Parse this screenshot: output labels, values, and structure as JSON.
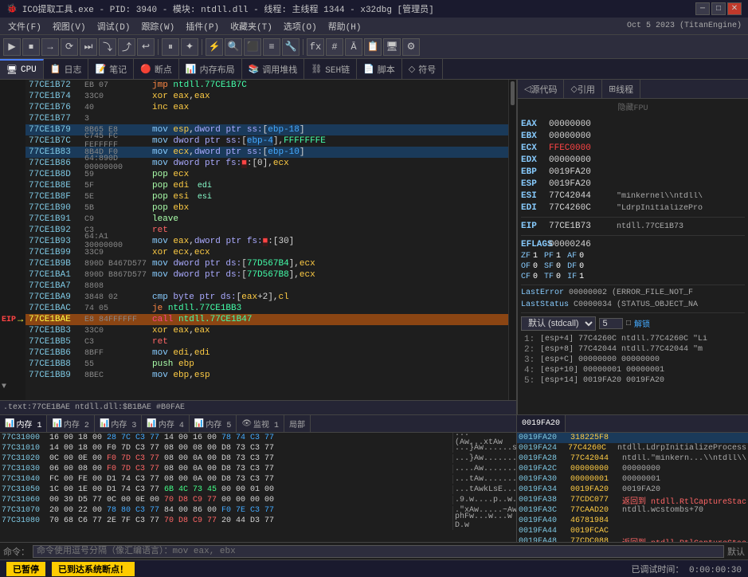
{
  "titlebar": {
    "title": "ICO提取工具.exe - PID: 3940 - 模块: ntdll.dll - 线程: 主线程 1344 - x32dbg [管理员]",
    "icon": "🐞",
    "controls": [
      "─",
      "□",
      "✕"
    ]
  },
  "menubar": {
    "items": [
      "文件(F)",
      "视图(V)",
      "调试(D)",
      "跟踪(W)",
      "插件(P)",
      "收藏夹(T)",
      "选项(O)",
      "帮助(H)"
    ],
    "date": "Oct 5 2023 (TitanEngine)"
  },
  "tabs": {
    "main": [
      {
        "label": "CPU",
        "icon": "🖥",
        "active": true
      },
      {
        "label": "日志",
        "icon": "📋",
        "active": false
      },
      {
        "label": "笔记",
        "icon": "📝",
        "active": false
      },
      {
        "label": "断点",
        "icon": "🔴",
        "active": false
      },
      {
        "label": "内存布局",
        "icon": "📊",
        "active": false
      },
      {
        "label": "调用堆栈",
        "icon": "📚",
        "active": false
      },
      {
        "label": "SEH链",
        "icon": "⛓",
        "active": false
      },
      {
        "label": "脚本",
        "icon": "📄",
        "active": false
      },
      {
        "label": "符号",
        "icon": "◇",
        "active": false
      }
    ],
    "right": [
      {
        "label": "源代码",
        "icon": "◁",
        "active": false
      },
      {
        "label": "引用",
        "icon": "◇",
        "active": false
      },
      {
        "label": "线程",
        "icon": "⊞",
        "active": false
      }
    ]
  },
  "disasm": {
    "eip_label": "EIP",
    "rows": [
      {
        "addr": "77CE1B72",
        "bytes": "EB 07",
        "mnem": "jmp ntdll.77CE1B7C",
        "type": "jmp",
        "eip": false,
        "selected": false,
        "highlighted": false
      },
      {
        "addr": "77CE1B74",
        "bytes": "33C0",
        "mnem": "xor eax,eax",
        "type": "xor",
        "eip": false,
        "selected": false,
        "highlighted": false
      },
      {
        "addr": "77CE1B76",
        "bytes": "40",
        "mnem": "inc eax",
        "type": "inc",
        "eip": false,
        "selected": false,
        "highlighted": false
      },
      {
        "addr": "77CE1B77",
        "bytes": "3",
        "mnem": "",
        "type": "",
        "eip": false,
        "selected": false,
        "highlighted": false
      },
      {
        "addr": "77CE1B79",
        "bytes": "8B65 E8",
        "mnem": "mov esp,dword ptr ss:[ebp-18]",
        "type": "mov",
        "eip": false,
        "selected": false,
        "highlighted": true
      },
      {
        "addr": "77CE1B7C",
        "bytes": "C745 FC FEFFFFF",
        "mnem": "mov dword ptr ss:[ebp-4],FFFFFFFE",
        "type": "mov",
        "eip": false,
        "selected": false,
        "highlighted": false
      },
      {
        "addr": "77CE1B83",
        "bytes": "8B4D F0",
        "mnem": "mov ecx,dword ptr ss:[ebp-10]",
        "type": "mov",
        "eip": false,
        "selected": false,
        "highlighted": true
      },
      {
        "addr": "77CE1B86",
        "bytes": "64:890D 00000000",
        "mnem": "mov dword ptr fs:■:[0],ecx",
        "type": "mov",
        "eip": false,
        "selected": false,
        "highlighted": false
      },
      {
        "addr": "77CE1B8D",
        "bytes": "59",
        "mnem": "pop ecx",
        "type": "pop",
        "eip": false,
        "selected": false,
        "highlighted": false
      },
      {
        "addr": "77CE1B8E",
        "bytes": "5F",
        "mnem": "pop edi",
        "type": "pop",
        "eip": false,
        "selected": false,
        "highlighted": false,
        "comment": "edi"
      },
      {
        "addr": "77CE1B8F",
        "bytes": "5E",
        "mnem": "pop esi",
        "type": "pop",
        "eip": false,
        "selected": false,
        "highlighted": false,
        "comment": "esi"
      },
      {
        "addr": "77CE1B90",
        "bytes": "5B",
        "mnem": "pop ebx",
        "type": "pop",
        "eip": false,
        "selected": false,
        "highlighted": false
      },
      {
        "addr": "77CE1B91",
        "bytes": "C9",
        "mnem": "leave",
        "type": "leave",
        "eip": false,
        "selected": false,
        "highlighted": false
      },
      {
        "addr": "77CE1B92",
        "bytes": "C3",
        "mnem": "ret",
        "type": "ret",
        "eip": false,
        "selected": false,
        "highlighted": false
      },
      {
        "addr": "77CE1B93",
        "bytes": "64:A1 30000000",
        "mnem": "mov eax,dword ptr fs:■:[30]",
        "type": "mov",
        "eip": false,
        "selected": false,
        "highlighted": false
      },
      {
        "addr": "77CE1B99",
        "bytes": "33C9",
        "mnem": "xor ecx,ecx",
        "type": "xor",
        "eip": false,
        "selected": false,
        "highlighted": false
      },
      {
        "addr": "77CE1B9B",
        "bytes": "890D B467D577",
        "mnem": "mov dword ptr ds:[77D567B4],ecx",
        "type": "mov",
        "eip": false,
        "selected": false,
        "highlighted": false
      },
      {
        "addr": "77CE1BA1",
        "bytes": "890D B867D577",
        "mnem": "mov dword ptr ds:[77D567B8],ecx",
        "type": "mov",
        "eip": false,
        "selected": false,
        "highlighted": false
      },
      {
        "addr": "77CE1BA7",
        "bytes": "8808",
        "mnem": "",
        "type": "",
        "eip": false,
        "selected": false,
        "highlighted": false
      },
      {
        "addr": "77CE1BA9",
        "bytes": "3848 02",
        "mnem": "cmp byte ptr ds:[eax+2],cl",
        "type": "cmp",
        "eip": false,
        "selected": false,
        "highlighted": false
      },
      {
        "addr": "77CE1BAC",
        "bytes": "74 05",
        "mnem": "je ntdll.77CE1BB3",
        "type": "je",
        "eip": false,
        "selected": false,
        "highlighted": false,
        "arrow": "▼"
      },
      {
        "addr": "77CE1BAE",
        "bytes": "E8 84FFFFFF",
        "mnem": "call ntdll.77CE1B47",
        "type": "call",
        "eip": true,
        "selected": true,
        "highlighted": false
      },
      {
        "addr": "77CE1BB3",
        "bytes": "33C0",
        "mnem": "xor eax,eax",
        "type": "xor",
        "eip": false,
        "selected": false,
        "highlighted": false
      },
      {
        "addr": "77CE1BB5",
        "bytes": "C3",
        "mnem": "ret",
        "type": "ret",
        "eip": false,
        "selected": false,
        "highlighted": false
      },
      {
        "addr": "77CE1BB6",
        "bytes": "8BFF",
        "mnem": "mov edi,edi",
        "type": "mov",
        "eip": false,
        "selected": false,
        "highlighted": false
      },
      {
        "addr": "77CE1BB8",
        "bytes": "55",
        "mnem": "push ebp",
        "type": "push",
        "eip": false,
        "selected": false,
        "highlighted": false
      },
      {
        "addr": "77CE1BB9",
        "bytes": "8BEC",
        "mnem": "mov ebp,esp",
        "type": "mov",
        "eip": false,
        "selected": false,
        "highlighted": false
      }
    ],
    "footer": ".text:77CE1BAE  ntdll.dll:$B1BAE  #B0FAE"
  },
  "registers": {
    "title": "隐藏FPU",
    "regs": [
      {
        "name": "EAX",
        "value": "00000000",
        "info": ""
      },
      {
        "name": "EBX",
        "value": "00000000",
        "info": ""
      },
      {
        "name": "ECX",
        "value": "FFEC0000",
        "info": "",
        "changed": true
      },
      {
        "name": "EDX",
        "value": "00000000",
        "info": ""
      },
      {
        "name": "EBP",
        "value": "0019FA20",
        "info": ""
      },
      {
        "name": "ESP",
        "value": "0019FA20",
        "info": ""
      },
      {
        "name": "ESI",
        "value": "77C42044",
        "info": "\"minkernel\\\\ntdll\\\\"
      },
      {
        "name": "EDI",
        "value": "77C4260C",
        "info": "\"LdrpInitializePro"
      },
      {
        "name": "EIP",
        "value": "77CE1B73",
        "info": "ntdll.77CE1B73"
      }
    ],
    "flags": {
      "title": "EFLAGS",
      "value": "00000246",
      "items": [
        {
          "name": "ZF",
          "val": "1"
        },
        {
          "name": "PF",
          "val": "1"
        },
        {
          "name": "AF",
          "val": "0"
        },
        {
          "name": "OF",
          "val": "0"
        },
        {
          "name": "SF",
          "val": "0"
        },
        {
          "name": "DF",
          "val": "0"
        },
        {
          "name": "CF",
          "val": "0"
        },
        {
          "name": "TF",
          "val": "0"
        },
        {
          "name": "IF",
          "val": "1"
        }
      ]
    },
    "lasterror": "00000002 (ERROR_FILE_NOT_F",
    "laststatus": "C0000034 (STATUS_OBJECT_NA"
  },
  "stack": {
    "calling_convention": "默认 (stdcall)",
    "arg_count": "5",
    "unlock_label": "解锁",
    "rows": [
      {
        "idx": "1:",
        "content": "[esp+4]  77C4260C  ntdll.77C4260C  \"Li"
      },
      {
        "idx": "2:",
        "content": "[esp+8]  77C42044  ntdll.77C42044  \"m"
      },
      {
        "idx": "3:",
        "content": "[esp+C]  00000000  00000000"
      },
      {
        "idx": "4:",
        "content": "[esp+10] 00000001  00000001"
      },
      {
        "idx": "5:",
        "content": "[esp+14] 0019FA20  0019FA20"
      }
    ]
  },
  "memory_tabs": [
    {
      "label": "内存 1",
      "active": true
    },
    {
      "label": "内存 2",
      "active": false
    },
    {
      "label": "内存 3",
      "active": false
    },
    {
      "label": "内存 4",
      "active": false
    },
    {
      "label": "内存 5",
      "active": false
    },
    {
      "label": "监视 1",
      "active": false
    },
    {
      "label": "局部",
      "active": false
    }
  ],
  "memory": {
    "rows": [
      {
        "addr": "77C31000",
        "bytes": "16 00 18 00  28 7C C3 77  14 00 16 00  78 74 C3 77",
        "ascii": "....(Aw...xtAw"
      },
      {
        "addr": "77C31010",
        "bytes": "14 00 18 00  F0 7D C3 77  08 00 08 00  D8 73 C3 77",
        "ascii": "...}Aw......sAw"
      },
      {
        "addr": "77C31020",
        "bytes": "0C 00 0E 00  F0 7D C3 77  08 00 0A 00  D8 73 C3 77",
        "ascii": "...}Aw.......sAw"
      },
      {
        "addr": "77C31030",
        "bytes": "06 00 08 00  F0 7D C3 77  08 00 0A 00  D8 73 C3 77",
        "ascii": "....Aw.......Aw"
      },
      {
        "addr": "77C31040",
        "bytes": "FC 00 FE 00  D1 74 C3 77  08 00 0A 00  D8 73 C3 77",
        "ascii": "...tAw.......sAw"
      },
      {
        "addr": "77C31050",
        "bytes": "1C 00 1E 00  D1 74 C3 77  6B 4C 73 45  00 00 01 00",
        "ascii": "...tAwkLsE......"
      },
      {
        "addr": "77C31060",
        "bytes": "00 39 D5 77  0C 00 0E 00  70 D8 C9 77  00 00 00 00",
        "ascii": ".9.w....p..w...."
      },
      {
        "addr": "77C31070",
        "bytes": "20 00 22 00  78 80 C3 77  84 00 86 00  F0 7E C3 77",
        "ascii": " .\"xAw.....~Aw"
      },
      {
        "addr": "77C31080",
        "bytes": "70 68 C6 77  2E 7F C3 77  70 D8 C9 77  20 44 D3 77",
        "ascii": "phFw...w...w D.w"
      }
    ]
  },
  "right_bottom": {
    "tabs": [
      {
        "label": "0019FA20",
        "active": true
      }
    ],
    "rows": [
      {
        "addr": "0019FA24",
        "val": "77C4260C",
        "info": "ntdll.LdrpInitializeProcess"
      },
      {
        "addr": "0019FA28",
        "val": "77C42044",
        "info": "ntdll.\"minkern...\\\\ntdll\\\\drini"
      },
      {
        "addr": "0019FA2C",
        "val": "00000000",
        "info": "00000000"
      },
      {
        "addr": "0019FA30",
        "val": "00000001",
        "info": "00000001"
      },
      {
        "addr": "0019FA34",
        "val": "0019FA20",
        "info": "0019FA20"
      },
      {
        "addr": "0019FA38",
        "val": "77CDC077",
        "info": "返回到 ntdll.RtlCaptureStackCont",
        "highlight": true
      },
      {
        "addr": "0019FA3C",
        "val": "77CAAD20",
        "info": "ntdll.wcstombs+70"
      },
      {
        "addr": "0019FA40",
        "val": "46781984",
        "info": ""
      },
      {
        "addr": "0019FA44",
        "val": "0019FCAC",
        "info": ""
      },
      {
        "addr": "0019FA48",
        "val": "77CDC088",
        "info": "返回到 ntdll.RtlCaptureStackCont",
        "highlight": true
      }
    ]
  },
  "cmd": {
    "label": "命令：",
    "placeholder": "命令使用逗号分隔（像汇编语言）：mov eax, ebx",
    "default_label": "默认"
  },
  "statusbar": {
    "paused_label": "已暂停",
    "breakpoint_label": "已到达系统断点！",
    "time_label": "已调试时间：",
    "time_value": "0:00:00:30"
  }
}
